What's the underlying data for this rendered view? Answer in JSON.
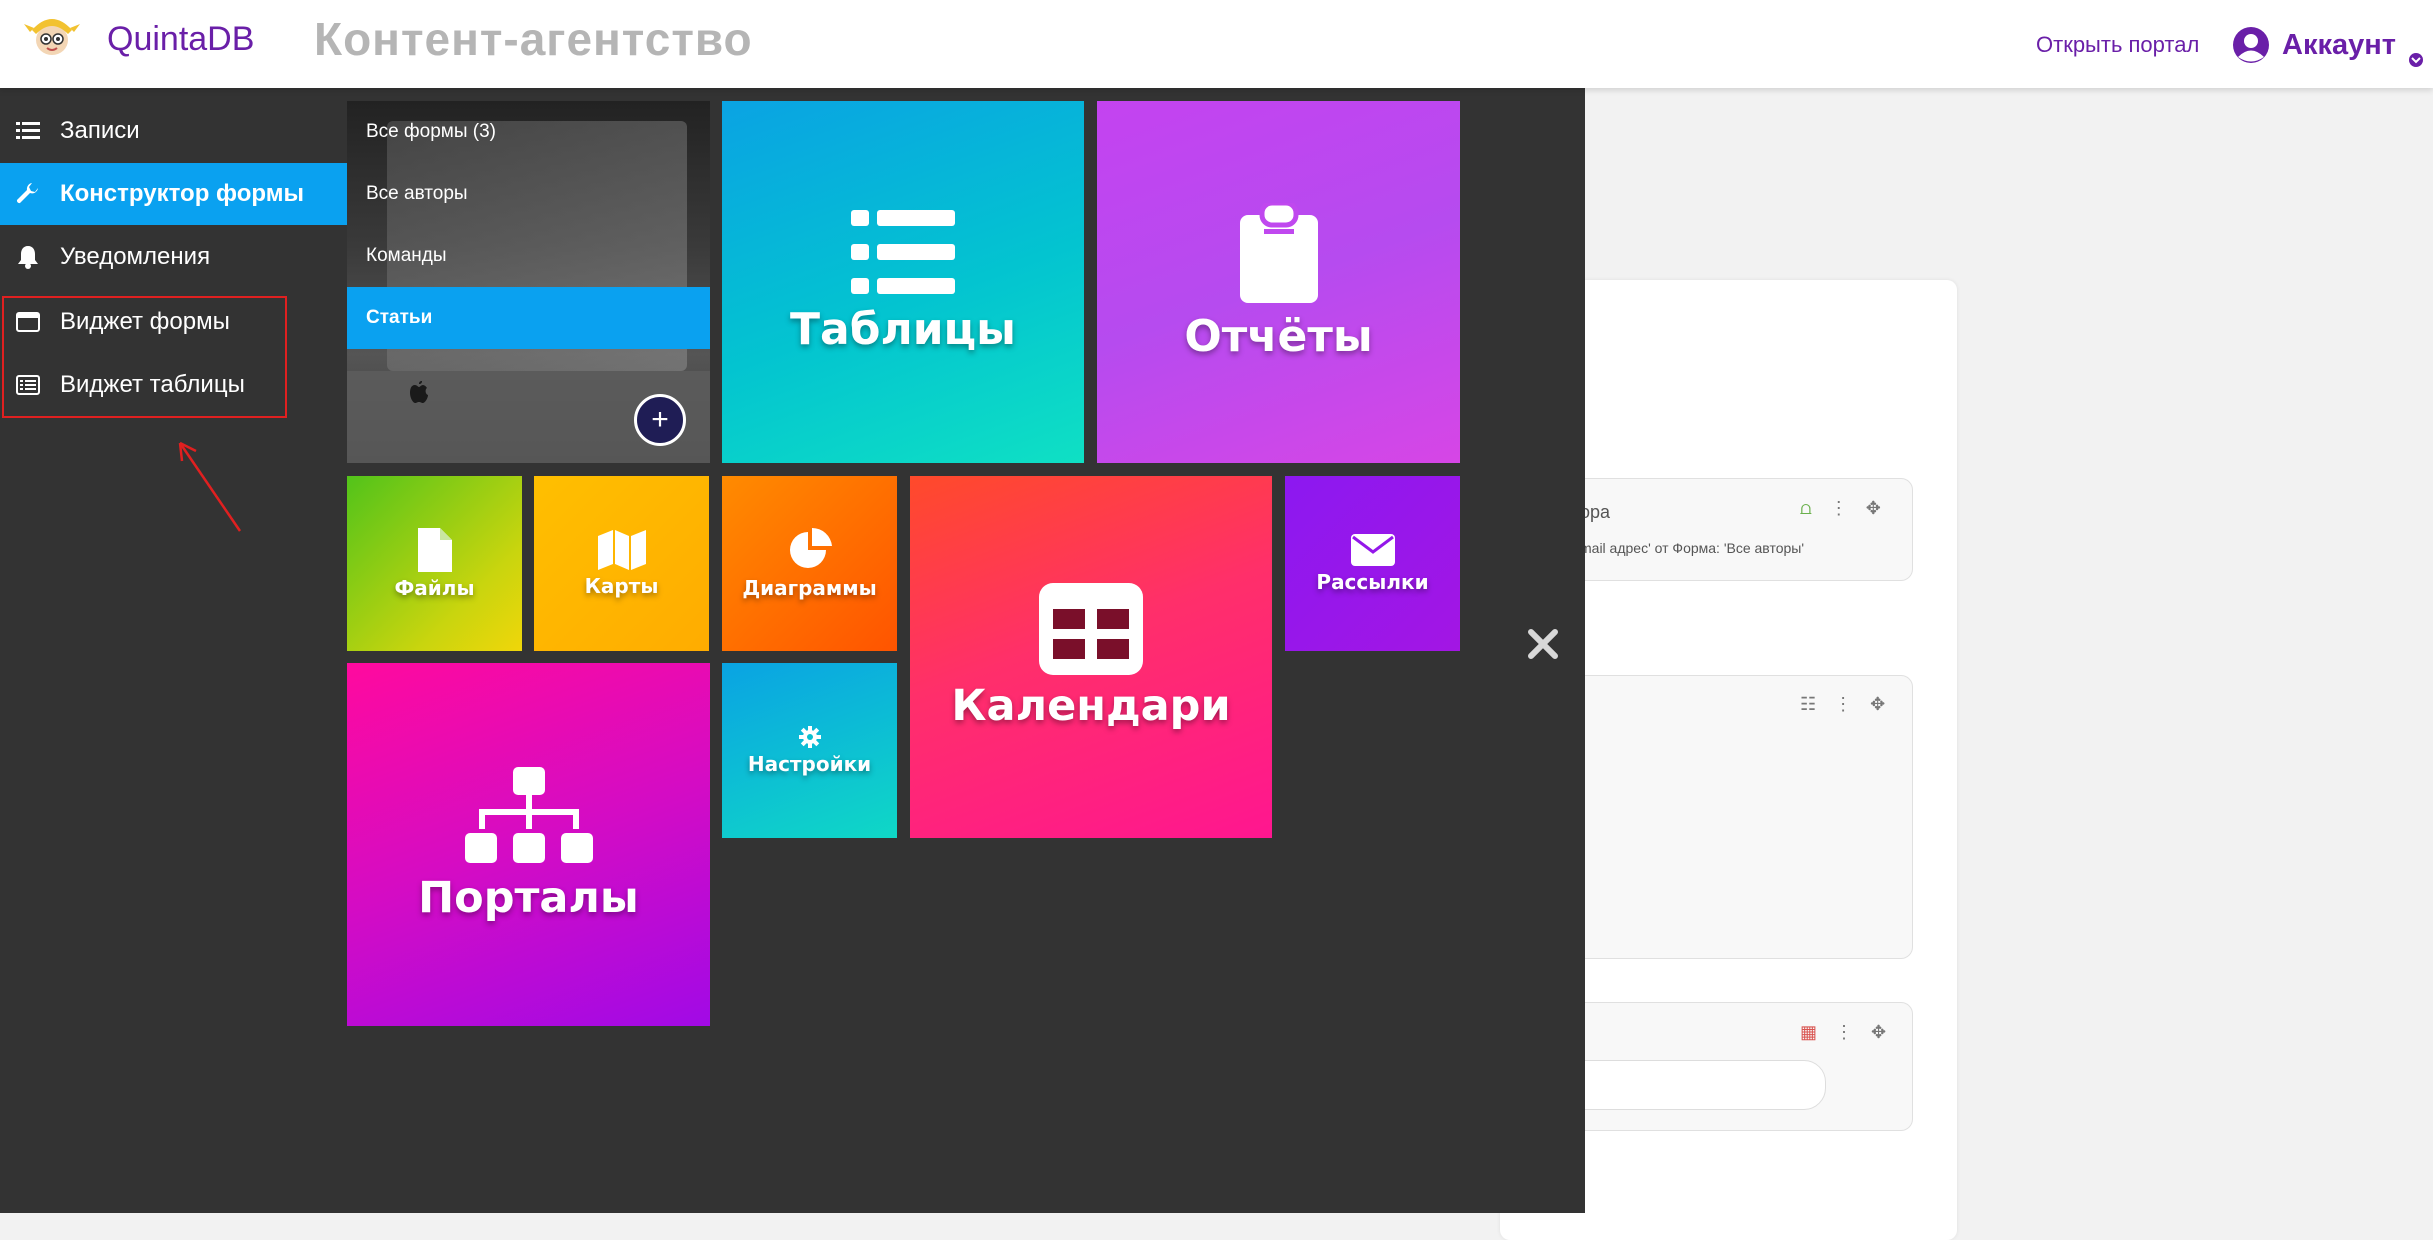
{
  "header": {
    "logo_text": "QuintaDB",
    "db_title": "Контент-агентство",
    "open_portal": "Открыть портал",
    "account": "Аккаунт"
  },
  "sidebar": {
    "items": [
      {
        "label": "Записи",
        "icon": "list-icon"
      },
      {
        "label": "Конструктор формы",
        "icon": "wrench-icon",
        "active": true
      },
      {
        "label": "Уведомления",
        "icon": "bell-icon"
      },
      {
        "label": "Виджет формы",
        "icon": "window-icon"
      },
      {
        "label": "Виджет таблицы",
        "icon": "table-list-icon"
      }
    ]
  },
  "forms": {
    "items": [
      {
        "label": "Все формы (3)"
      },
      {
        "label": "Все авторы"
      },
      {
        "label": "Команды"
      },
      {
        "label": "Статьи",
        "active": true
      }
    ],
    "add_label": "+"
  },
  "tiles": {
    "tables": "Таблицы",
    "reports": "Отчёты",
    "files": "Файлы",
    "maps": "Карты",
    "charts": "Диаграммы",
    "calendar": "Календари",
    "mail": "Рассылки",
    "portals": "Порталы",
    "settings": "Настройки"
  },
  "background_form": {
    "field1_label": "ора",
    "field1_hint": "mail адрес' от Форма: 'Все авторы'"
  },
  "colors": {
    "accent": "#0aa1f0",
    "brand": "#6a1fa8",
    "sidebar_bg": "#333333",
    "highlight_box": "#e02020"
  }
}
